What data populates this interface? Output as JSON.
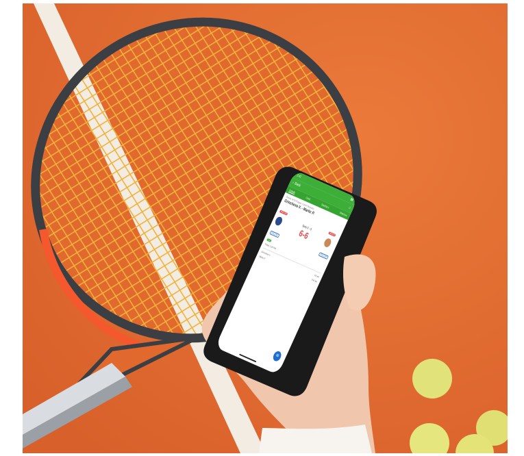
{
  "colors": {
    "clay": "#e2692d",
    "court_line": "#f2ece3",
    "racket_string": "#f0b23a",
    "racket_frame": "#3b3f44",
    "app_green": "#3dae38",
    "score_red": "#e24a4a",
    "fab_blue": "#1f6fd1",
    "ball": "#e2e27a"
  },
  "phone": {
    "status_time": "2:42",
    "back_label": "Back",
    "tabs": [
      "Details",
      "Odds",
      "Statistics",
      "Matches"
    ],
    "breadcrumb": "Tennis, WTA Prague, Czech Republic",
    "match_title": "Grincheva V. - Martic P.",
    "badge_home": "WTA 150",
    "badge_away": "WTA 62",
    "follow_label": "FOLLOW",
    "set_status": "Sets 0 - 0",
    "score": "6-6",
    "live_badge": "Live",
    "time_label": "Today, 1:30 PM",
    "player_home": "Grincheva V.",
    "player_away": "Martic P.",
    "first_set": "1st set",
    "second_set": "2nd set",
    "fab_icon": "chat-icon"
  }
}
